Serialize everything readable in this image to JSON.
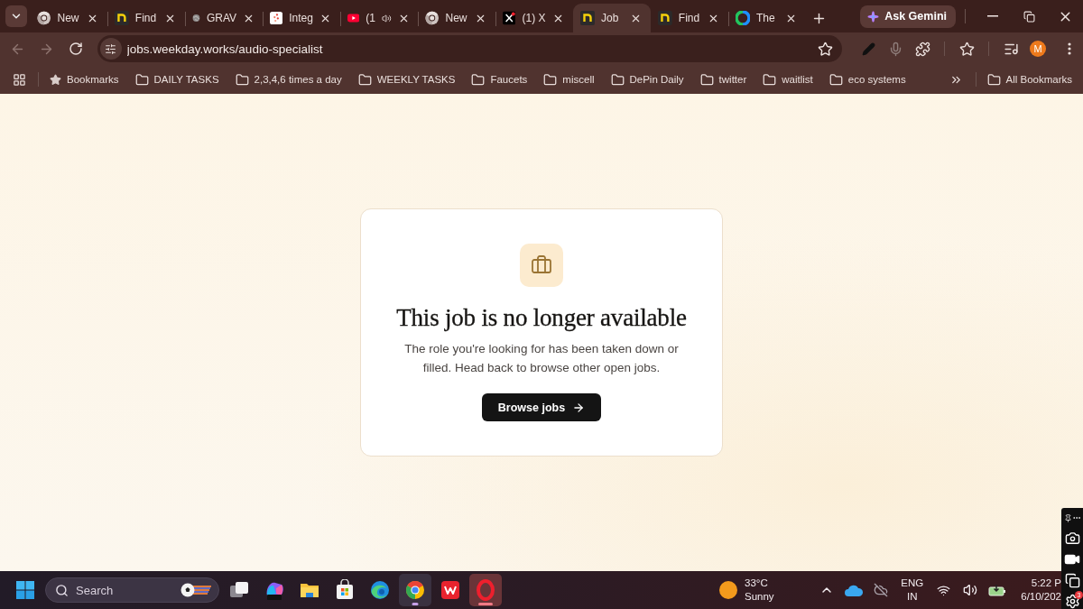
{
  "browser": {
    "tabs": [
      {
        "title": "New",
        "kind": "chrome",
        "audio": false,
        "selected": false
      },
      {
        "title": "Find",
        "kind": "weekday",
        "audio": false,
        "selected": false
      },
      {
        "title": "GRAV",
        "kind": "globe",
        "audio": false,
        "selected": false
      },
      {
        "title": "Integ",
        "kind": "dots",
        "audio": false,
        "selected": false
      },
      {
        "title": "(1",
        "kind": "video",
        "audio": true,
        "selected": false
      },
      {
        "title": "New",
        "kind": "chrome",
        "audio": false,
        "selected": false
      },
      {
        "title": "(1) X",
        "kind": "x",
        "audio": false,
        "selected": false
      },
      {
        "title": "Job",
        "kind": "weekday",
        "audio": false,
        "selected": true
      },
      {
        "title": "Find",
        "kind": "weekday",
        "audio": false,
        "selected": false
      },
      {
        "title": "The",
        "kind": "ring",
        "audio": false,
        "selected": false
      }
    ],
    "ask_gemini": "Ask Gemini",
    "back": {
      "disabled": true
    },
    "forward": {
      "disabled": true
    },
    "address": "jobs.weekday.works/audio-specialist",
    "profile_initial": "M"
  },
  "bookmarks_bar": {
    "bookmarks": "Bookmarks",
    "folders": [
      "DAILY TASKS",
      "2,3,4,6 times a day",
      "WEEKLY TASKS",
      "Faucets",
      "miscell",
      "DePin Daily",
      "twitter",
      "waitlist",
      "eco systems"
    ],
    "all_bookmarks": "All Bookmarks"
  },
  "page": {
    "title": "This job is no longer available",
    "message": "The role you're looking for has been taken down or filled. Head back to browse other open jobs.",
    "button": "Browse jobs"
  },
  "taskbar": {
    "search_label": "Search",
    "apps": [
      {
        "kind": "task-view",
        "running": false,
        "selected": false
      },
      {
        "kind": "m365",
        "running": false,
        "selected": false
      },
      {
        "kind": "files",
        "running": false,
        "selected": false
      },
      {
        "kind": "store",
        "running": false,
        "selected": false
      },
      {
        "kind": "edge",
        "running": false,
        "selected": false
      },
      {
        "kind": "chrome",
        "running": true,
        "selected": false
      },
      {
        "kind": "wps",
        "running": false,
        "selected": false
      },
      {
        "kind": "opera",
        "running": true,
        "selected": true
      }
    ],
    "weather": {
      "temperature": "33°C",
      "condition": "Sunny"
    },
    "language": [
      "ENG",
      "IN"
    ],
    "time": "5:22 P",
    "date": "6/10/202"
  },
  "capture_toolbar": {
    "badge": "3"
  }
}
